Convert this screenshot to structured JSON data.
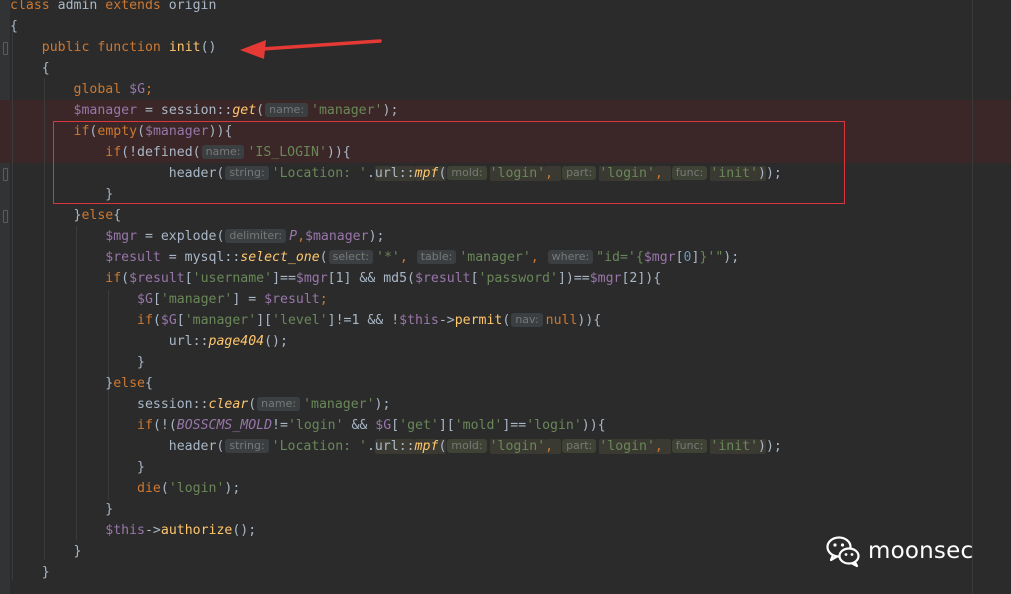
{
  "editor": {
    "theme": "Darcula",
    "colors": {
      "background": "#2b2b2b",
      "keyword": "#cc7832",
      "variable": "#9876aa",
      "string": "#6a8759",
      "function": "#ffc66d",
      "text": "#a9b7c6",
      "hint_text": "#787878",
      "highlight_box": "#d9363e",
      "arrow": "#e53935"
    },
    "lines": [
      [
        {
          "t": "class",
          "c": "k"
        },
        {
          "t": " admin ",
          "c": "c"
        },
        {
          "t": "extends",
          "c": "k"
        },
        {
          "t": " origin",
          "c": "c"
        }
      ],
      [
        {
          "t": "{",
          "c": "c"
        }
      ],
      [
        {
          "t": "    ",
          "c": "c"
        },
        {
          "t": "public",
          "c": "k"
        },
        {
          "t": " ",
          "c": "c"
        },
        {
          "t": "function",
          "c": "k"
        },
        {
          "t": " ",
          "c": "c"
        },
        {
          "t": "init",
          "c": "f"
        },
        {
          "t": "()",
          "c": "c"
        }
      ],
      [
        {
          "t": "    {",
          "c": "c"
        }
      ],
      [
        {
          "t": "        ",
          "c": "c"
        },
        {
          "t": "global",
          "c": "k"
        },
        {
          "t": " ",
          "c": "c"
        },
        {
          "t": "$G",
          "c": "v"
        },
        {
          "t": ";",
          "c": "k"
        }
      ],
      [
        {
          "t": "        ",
          "c": "c"
        },
        {
          "t": "$manager",
          "c": "v"
        },
        {
          "t": " = session::",
          "c": "c"
        },
        {
          "t": "get",
          "c": "fi"
        },
        {
          "t": "(",
          "c": "c"
        },
        {
          "h": "name:"
        },
        {
          "t": "'manager'",
          "c": "s"
        },
        {
          "t": ");",
          "c": "c"
        }
      ],
      [
        {
          "t": "        ",
          "c": "c"
        },
        {
          "t": "if",
          "c": "k"
        },
        {
          "t": "(",
          "c": "c"
        },
        {
          "t": "empty",
          "c": "k"
        },
        {
          "t": "(",
          "c": "c"
        },
        {
          "t": "$manager",
          "c": "v"
        },
        {
          "t": ")){",
          "c": "c"
        }
      ],
      [
        {
          "t": "            ",
          "c": "c"
        },
        {
          "t": "if",
          "c": "k"
        },
        {
          "t": "(!defined(",
          "c": "c"
        },
        {
          "h": "name:"
        },
        {
          "t": "'IS_LOGIN'",
          "c": "s"
        },
        {
          "t": ")){",
          "c": "c"
        }
      ],
      [
        {
          "t": "                    header(",
          "c": "c"
        },
        {
          "h": "string:"
        },
        {
          "t": "'Location: '",
          "c": "s"
        },
        {
          "t": ".",
          "c": "c"
        },
        {
          "t": "url::",
          "c": "c",
          "hl": 1
        },
        {
          "t": "mpf",
          "c": "fi",
          "hl": 1
        },
        {
          "t": "(",
          "c": "c",
          "hl": 1
        },
        {
          "h": "mold:",
          "hl": 1
        },
        {
          "t": "'login'",
          "c": "s",
          "hl": 1
        },
        {
          "t": ", ",
          "c": "k",
          "hl": 1
        },
        {
          "h": "part:",
          "hl": 1
        },
        {
          "t": "'login'",
          "c": "s",
          "hl": 1
        },
        {
          "t": ", ",
          "c": "k",
          "hl": 1
        },
        {
          "h": "func:",
          "hl": 1
        },
        {
          "t": "'init'",
          "c": "s",
          "hl": 1
        },
        {
          "t": ")",
          "c": "c",
          "hl": 1
        },
        {
          "t": ");",
          "c": "c"
        }
      ],
      [
        {
          "t": "            }",
          "c": "c"
        }
      ],
      [
        {
          "t": "        }",
          "c": "c"
        },
        {
          "t": "else",
          "c": "k"
        },
        {
          "t": "{",
          "c": "c"
        }
      ],
      [
        {
          "t": "            ",
          "c": "c"
        },
        {
          "t": "$mgr",
          "c": "v"
        },
        {
          "t": " = explode(",
          "c": "c"
        },
        {
          "h": "delimiter:"
        },
        {
          "t": "P",
          "c": "cst"
        },
        {
          "t": ",",
          "c": "k"
        },
        {
          "t": "$manager",
          "c": "v"
        },
        {
          "t": ");",
          "c": "c"
        }
      ],
      [
        {
          "t": "            ",
          "c": "c"
        },
        {
          "t": "$result",
          "c": "v"
        },
        {
          "t": " = mysql::",
          "c": "c"
        },
        {
          "t": "select_one",
          "c": "fi"
        },
        {
          "t": "(",
          "c": "c"
        },
        {
          "h": "select:"
        },
        {
          "t": "'*'",
          "c": "s"
        },
        {
          "t": ", ",
          "c": "k"
        },
        {
          "h": "table:"
        },
        {
          "t": "'manager'",
          "c": "s"
        },
        {
          "t": ", ",
          "c": "k"
        },
        {
          "h": "where:"
        },
        {
          "t": "\"id='{",
          "c": "s"
        },
        {
          "t": "$mgr",
          "c": "v"
        },
        {
          "t": "[",
          "c": "c"
        },
        {
          "t": "0",
          "c": "n"
        },
        {
          "t": "]",
          "c": "c"
        },
        {
          "t": "}'\"",
          "c": "s"
        },
        {
          "t": ");",
          "c": "c"
        }
      ],
      [
        {
          "t": "            ",
          "c": "c"
        },
        {
          "t": "if",
          "c": "k"
        },
        {
          "t": "(",
          "c": "c"
        },
        {
          "t": "$result",
          "c": "v"
        },
        {
          "t": "[",
          "c": "c"
        },
        {
          "t": "'username'",
          "c": "s"
        },
        {
          "t": "]==",
          "c": "c"
        },
        {
          "t": "$mgr",
          "c": "v"
        },
        {
          "t": "[1] && md5(",
          "c": "c"
        },
        {
          "t": "$result",
          "c": "v"
        },
        {
          "t": "[",
          "c": "c"
        },
        {
          "t": "'password'",
          "c": "s"
        },
        {
          "t": "])==",
          "c": "c"
        },
        {
          "t": "$mgr",
          "c": "v"
        },
        {
          "t": "[2]){",
          "c": "c"
        }
      ],
      [
        {
          "t": "                ",
          "c": "c"
        },
        {
          "t": "$G",
          "c": "v"
        },
        {
          "t": "[",
          "c": "c"
        },
        {
          "t": "'manager'",
          "c": "s"
        },
        {
          "t": "] = ",
          "c": "c"
        },
        {
          "t": "$result",
          "c": "v"
        },
        {
          "t": ";",
          "c": "k"
        }
      ],
      [
        {
          "t": "                ",
          "c": "c"
        },
        {
          "t": "if",
          "c": "k"
        },
        {
          "t": "(",
          "c": "c"
        },
        {
          "t": "$G",
          "c": "v"
        },
        {
          "t": "[",
          "c": "c"
        },
        {
          "t": "'manager'",
          "c": "s"
        },
        {
          "t": "][",
          "c": "c"
        },
        {
          "t": "'level'",
          "c": "s"
        },
        {
          "t": "]!=1 && !",
          "c": "c"
        },
        {
          "t": "$this",
          "c": "v"
        },
        {
          "t": "->",
          "c": "c"
        },
        {
          "t": "permit",
          "c": "f"
        },
        {
          "t": "(",
          "c": "c"
        },
        {
          "h": "nav:"
        },
        {
          "t": "null",
          "c": "k"
        },
        {
          "t": ")){",
          "c": "c"
        }
      ],
      [
        {
          "t": "                    url::",
          "c": "c"
        },
        {
          "t": "page404",
          "c": "fi"
        },
        {
          "t": "();",
          "c": "c"
        }
      ],
      [
        {
          "t": "                }",
          "c": "c"
        }
      ],
      [
        {
          "t": "            }",
          "c": "c"
        },
        {
          "t": "else",
          "c": "k"
        },
        {
          "t": "{",
          "c": "c"
        }
      ],
      [
        {
          "t": "                session::",
          "c": "c"
        },
        {
          "t": "clear",
          "c": "fi"
        },
        {
          "t": "(",
          "c": "c"
        },
        {
          "h": "name:"
        },
        {
          "t": "'manager'",
          "c": "s"
        },
        {
          "t": ");",
          "c": "c"
        }
      ],
      [
        {
          "t": "                ",
          "c": "c"
        },
        {
          "t": "if",
          "c": "k"
        },
        {
          "t": "(!(",
          "c": "c"
        },
        {
          "t": "BOSSCMS_MOLD",
          "c": "cst"
        },
        {
          "t": "!=",
          "c": "c"
        },
        {
          "t": "'login'",
          "c": "s"
        },
        {
          "t": " && ",
          "c": "c"
        },
        {
          "t": "$G",
          "c": "v"
        },
        {
          "t": "[",
          "c": "c"
        },
        {
          "t": "'get'",
          "c": "s"
        },
        {
          "t": "][",
          "c": "c"
        },
        {
          "t": "'mold'",
          "c": "s"
        },
        {
          "t": "]==",
          "c": "c"
        },
        {
          "t": "'login'",
          "c": "s"
        },
        {
          "t": ")){",
          "c": "c"
        }
      ],
      [
        {
          "t": "                    header(",
          "c": "c"
        },
        {
          "h": "string:"
        },
        {
          "t": "'Location: '",
          "c": "s"
        },
        {
          "t": ".",
          "c": "c"
        },
        {
          "t": "url::",
          "c": "c",
          "hl": 1
        },
        {
          "t": "mpf",
          "c": "fi",
          "hl": 1
        },
        {
          "t": "(",
          "c": "c",
          "hl": 1
        },
        {
          "h": "mold:",
          "hl": 1
        },
        {
          "t": "'login'",
          "c": "s",
          "hl": 1
        },
        {
          "t": ", ",
          "c": "k",
          "hl": 1
        },
        {
          "h": "part:",
          "hl": 1
        },
        {
          "t": "'login'",
          "c": "s",
          "hl": 1
        },
        {
          "t": ", ",
          "c": "k",
          "hl": 1
        },
        {
          "h": "func:",
          "hl": 1
        },
        {
          "t": "'init'",
          "c": "s",
          "hl": 1
        },
        {
          "t": ")",
          "c": "c",
          "hl": 1
        },
        {
          "t": ");",
          "c": "c"
        }
      ],
      [
        {
          "t": "                }",
          "c": "c"
        }
      ],
      [
        {
          "t": "                ",
          "c": "c"
        },
        {
          "t": "die",
          "c": "k"
        },
        {
          "t": "(",
          "c": "c"
        },
        {
          "t": "'login'",
          "c": "s"
        },
        {
          "t": ");",
          "c": "c"
        }
      ],
      [
        {
          "t": "            }",
          "c": "c"
        }
      ],
      [
        {
          "t": "            ",
          "c": "c"
        },
        {
          "t": "$this",
          "c": "v"
        },
        {
          "t": "->",
          "c": "c"
        },
        {
          "t": "authorize",
          "c": "f"
        },
        {
          "t": "();",
          "c": "c"
        }
      ],
      [
        {
          "t": "        }",
          "c": "c"
        }
      ],
      [
        {
          "t": "    }",
          "c": "c"
        }
      ]
    ]
  },
  "watermark": {
    "text": "moonsec",
    "icon": "wechat-icon"
  }
}
